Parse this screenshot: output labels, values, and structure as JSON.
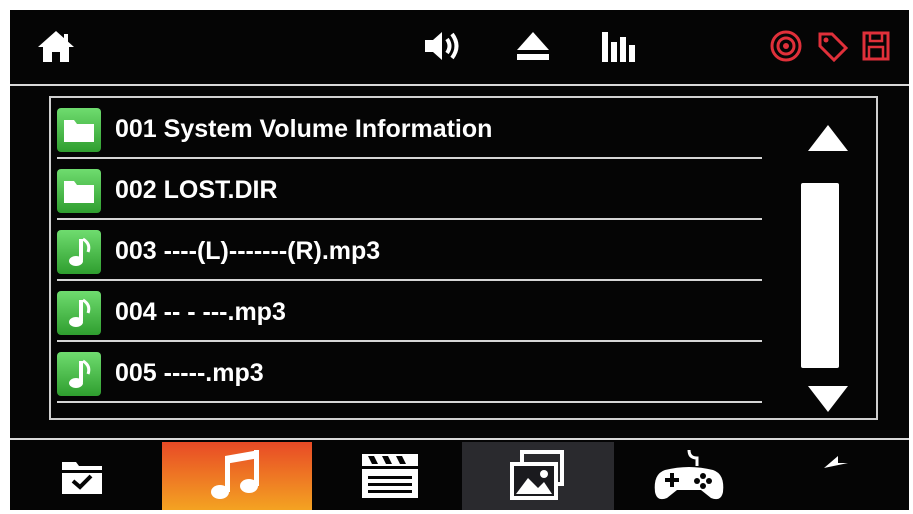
{
  "header": {
    "icons": [
      "home-icon",
      "volume-icon",
      "eject-icon",
      "equalizer-icon",
      "target-icon",
      "tag-icon",
      "save-icon"
    ]
  },
  "file_list": {
    "items": [
      {
        "label": "001 System Volume Information",
        "type": "folder"
      },
      {
        "label": "002 LOST.DIR",
        "type": "folder"
      },
      {
        "label": "003 ----(L)-------(R).mp3",
        "type": "audio"
      },
      {
        "label": "004 -- - ---.mp3",
        "type": "audio"
      },
      {
        "label": "005 -----.mp3",
        "type": "audio"
      }
    ]
  },
  "bottom_nav": {
    "tabs": [
      "files-tab",
      "music-tab",
      "video-tab",
      "photos-tab",
      "games-tab",
      "back-button"
    ],
    "active": "music-tab"
  },
  "colors": {
    "accent_gradient_top": "#e84a26",
    "accent_gradient_bottom": "#f4a322",
    "icon_red": "#e0303a",
    "row_icon_green": "#3cae3c"
  }
}
